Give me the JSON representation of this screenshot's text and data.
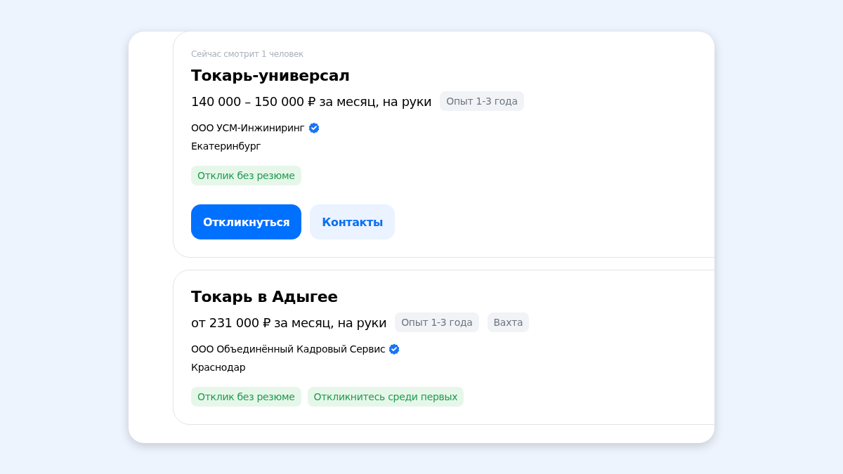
{
  "vacancies": [
    {
      "viewers": "Сейчас смотрит 1 человек",
      "title": "Токарь-универсал",
      "salary": "140 000 – 150 000 ₽ за месяц, на руки",
      "tags": [
        "Опыт 1-3 года"
      ],
      "company": "ООО УСМ-Инжиниринг",
      "verified": true,
      "city": "Екатеринбург",
      "badges": [
        "Отклик без резюме"
      ],
      "buttons": [
        {
          "label": "Откликнуться",
          "kind": "primary"
        },
        {
          "label": "Контакты",
          "kind": "secondary"
        }
      ]
    },
    {
      "title": "Токарь в Адыгее",
      "salary": "от 231 000 ₽ за месяц, на руки",
      "tags": [
        "Опыт 1-3 года",
        "Вахта"
      ],
      "company": "ООО Объединённый Кадровый Сервис",
      "verified": true,
      "city": "Краснодар",
      "badges": [
        "Отклик без резюме",
        "Откликнитесь среди первых"
      ]
    }
  ]
}
